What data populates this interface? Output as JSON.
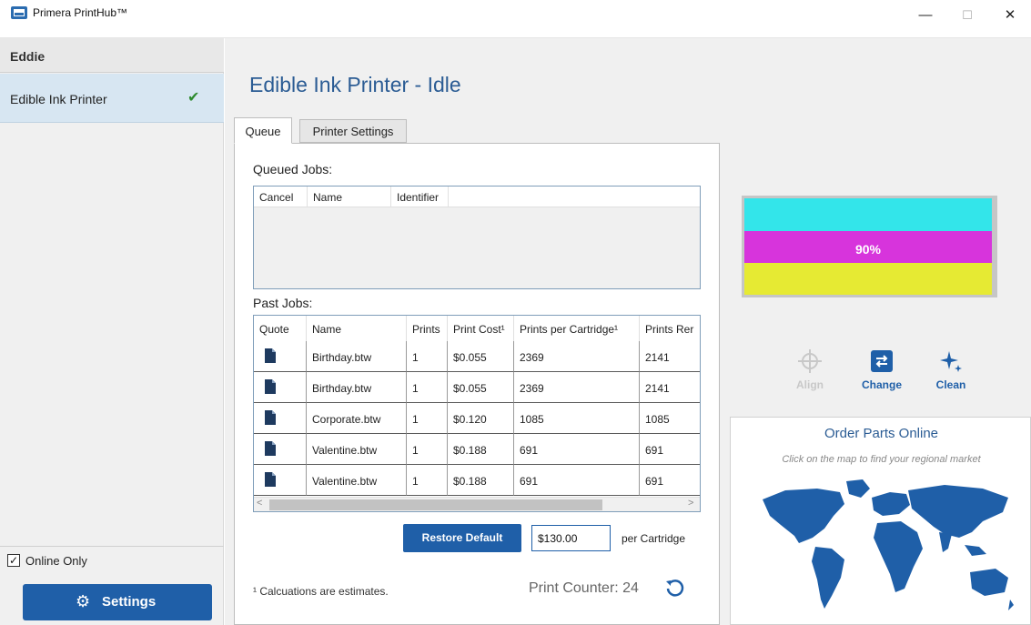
{
  "window": {
    "title": "Primera PrintHub™",
    "minimize": "—",
    "maximize": "☐",
    "close": "✕"
  },
  "sidebar": {
    "group": "Eddie",
    "printer": "Edible Ink Printer",
    "printer_status_icon": "check-icon",
    "online_only_label": "Online Only",
    "online_only_checked": true,
    "settings_label": "Settings"
  },
  "main": {
    "title": "Edible Ink Printer - Idle",
    "tabs": [
      {
        "label": "Queue",
        "active": true
      },
      {
        "label": "Printer Settings",
        "active": false
      }
    ],
    "queued": {
      "label": "Queued Jobs:",
      "columns": [
        "Cancel",
        "Name",
        "Identifier"
      ]
    },
    "past": {
      "label": "Past Jobs:",
      "columns": [
        "Quote",
        "Name",
        "Prints",
        "Print Cost¹",
        "Prints per Cartridge¹",
        "Prints Rer"
      ],
      "rows": [
        {
          "name": "Birthday.btw",
          "prints": "1",
          "cost": "$0.055",
          "per_cart": "2369",
          "remaining": "2141"
        },
        {
          "name": "Birthday.btw",
          "prints": "1",
          "cost": "$0.055",
          "per_cart": "2369",
          "remaining": "2141"
        },
        {
          "name": "Corporate.btw",
          "prints": "1",
          "cost": "$0.120",
          "per_cart": "1085",
          "remaining": "1085"
        },
        {
          "name": "Valentine.btw",
          "prints": "1",
          "cost": "$0.188",
          "per_cart": "691",
          "remaining": "691"
        },
        {
          "name": "Valentine.btw",
          "prints": "1",
          "cost": "$0.188",
          "per_cart": "691",
          "remaining": "691"
        }
      ]
    },
    "restore_default": "Restore Default",
    "cartridge_cost": "$130.00",
    "per_cartridge": "per Cartridge",
    "footnote": "¹ Calcuations are estimates.",
    "print_counter": "Print Counter: 24"
  },
  "cartridge": {
    "level_label": "90%",
    "level": 0.9,
    "colors": {
      "cyan": "#33e5ea",
      "magenta": "#d734dc",
      "yellow": "#e6ea33"
    }
  },
  "tools": {
    "align": "Align",
    "change": "Change",
    "clean": "Clean"
  },
  "order": {
    "title": "Order Parts Online",
    "subtitle": "Click on the map to find your regional market"
  },
  "colors": {
    "accent": "#1f5fa8",
    "title": "#2b5c94",
    "selection": "#d7e6f2"
  }
}
